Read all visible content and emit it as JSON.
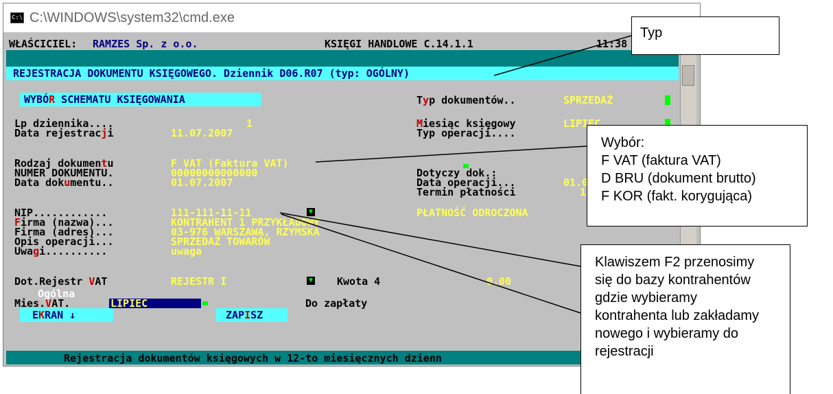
{
  "window": {
    "title": "C:\\WINDOWS\\system32\\cmd.exe",
    "icon": "cmd-icon"
  },
  "header": {
    "owner_label": "WŁAŚCICIEL:",
    "owner_value": "RAMZES Sp. z o.o.",
    "app_name": "KSIĘGI HANDLOWE C.14.1.1",
    "right_partial": "11:38"
  },
  "title_bar": "REJESTRACJA DOKUMENTU KSIĘGOWEGO. Dziennik D06.R07 (typ: OGÓLNY)",
  "schema_button": {
    "pre": "WYBÓ",
    "hot": "R",
    "post": " SCHEMATU KSIĘGOWANIA"
  },
  "fields": {
    "typ_dok": {
      "pre": "T",
      "hot": "y",
      "post": "p dokumentów..",
      "value": "SPRZEDAŻ"
    },
    "lp": {
      "label": "Lp dziennika....",
      "value": "1"
    },
    "miesiac": {
      "hot": "M",
      "post": "iesiąc księgowy",
      "value": "LIPIEC"
    },
    "data_rej": {
      "pre": "Data rejestrac",
      "hot": "j",
      "post": "i",
      "value": "11.07.2007"
    },
    "typ_oper": {
      "label": "Typ operacji...."
    },
    "rodzaj": {
      "pre": "Rodzaj dokumen",
      "hot": "t",
      "post": "u",
      "value": "F VAT (Faktura VAT)"
    },
    "numer": {
      "label": "NUMER DOKUMENTU.",
      "value": "00000000000000"
    },
    "dotyczy": {
      "label": "Dotyczy dok.:"
    },
    "data_dok": {
      "pre": "Data dok",
      "hot": "u",
      "post": "mentu..",
      "value": "01.07.2007"
    },
    "data_oper": {
      "label": "Data operacji...",
      "value": "01.0"
    },
    "termin": {
      "label": "Termin płatności",
      "value": "1"
    },
    "nip": {
      "label": "NIP............",
      "value": "111-111-11-11"
    },
    "platnosc": {
      "value": "PŁATNOŚĆ ODROCZONA"
    },
    "firma_nazwa": {
      "hot": "F",
      "post": "irma (nazwa)...",
      "value": "KONTRAHENT 1 PRZYKŁADOWY"
    },
    "firma_adres": {
      "label": "Firma (adres)...",
      "value": "03-976 WARSZAWA, RZYMSKA"
    },
    "opis": {
      "label": "Opis operacji...",
      "value": "SPRZEDAŻ TOWARÓW"
    },
    "uwagi": {
      "pre": "Uwa",
      "hot": "g",
      "post": "i..........",
      "value": "uwaga"
    },
    "dot_rej": {
      "pre": "Dot.Rejestr ",
      "hot": "V",
      "post": "AT",
      "value": "REJESTR I"
    },
    "kwota": {
      "label": "Kwota 4",
      "value": "0.00"
    },
    "ogolna": {
      "label": "Ogólna"
    },
    "mies_vat": {
      "pre": "Mies.",
      "hot": "V",
      "post": "AT.",
      "value": "LIPIEC"
    },
    "do_zaplaty": {
      "label": "Do zapłaty"
    }
  },
  "buttons": {
    "ekran": {
      "pre": "E",
      "hot": "K",
      "post": "RAN ↓"
    },
    "zapisz": {
      "pre": "ZAP",
      "hot": "I",
      "post": "SZ"
    }
  },
  "footer": "Rejestracja dokumentów księgowych w 12-to miesięcznych dzienn",
  "callouts": {
    "typ": {
      "lines": [
        "Typ"
      ]
    },
    "wybor": {
      "lines": [
        "Wybór:",
        "F VAT (faktura VAT)",
        "D BRU (dokument brutto)",
        "F KOR (fakt. korygująca)"
      ]
    },
    "f2": {
      "lines": [
        "Klawiszem F2 przenosimy",
        "się do bazy kontrahentów",
        "gdzie wybieramy",
        "kontrahenta lub zakładamy",
        "nowego i wybieramy do",
        "rejestracji"
      ]
    }
  },
  "colors": {
    "console_bg": "#c0c0c0",
    "field_value": "#ffff54",
    "hotkey": "#c00000",
    "teal": "#008080",
    "cyan": "#55ffff"
  }
}
